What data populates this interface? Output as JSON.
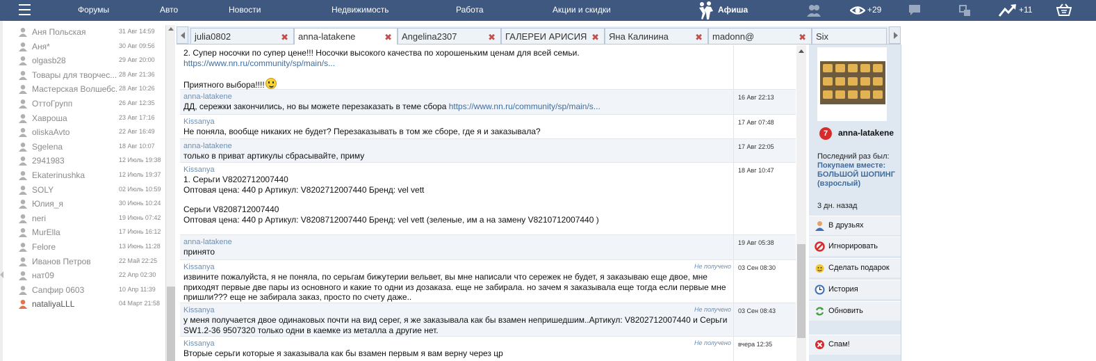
{
  "topbar": {
    "nav": [
      "Форумы",
      "Авто",
      "Новости",
      "Недвижимость",
      "Работа",
      "Акции и скидки"
    ],
    "afisha": "Афиша",
    "views_count": "+29",
    "notif_count": "+11",
    "bg_color": "#3e5880"
  },
  "contacts": [
    {
      "name": "Аня Польская",
      "date": "31 Авг 14:59"
    },
    {
      "name": "Аня*",
      "date": "30 Авг 09:56"
    },
    {
      "name": "olgasb28",
      "date": "29 Авг 20:00"
    },
    {
      "name": "Товары для творчес...",
      "date": "28 Авг 21:36"
    },
    {
      "name": "Мастерская Волшебс...",
      "date": "28 Авг 10:26"
    },
    {
      "name": "ОттоГрупп",
      "date": "26 Авг 12:35"
    },
    {
      "name": "Хаврошa",
      "date": "23 Авг 17:16"
    },
    {
      "name": "oliskaAvto",
      "date": "22 Авг 16:49"
    },
    {
      "name": "Sgelena",
      "date": "18 Авг 10:07"
    },
    {
      "name": "2941983",
      "date": "12 Июль 19:38"
    },
    {
      "name": "Ekaterinushka",
      "date": "12 Июль 19:37"
    },
    {
      "name": "SOLY",
      "date": "02 Июль 10:59"
    },
    {
      "name": "Юлия_я",
      "date": "30 Июнь 10:24"
    },
    {
      "name": "neri",
      "date": "19 Июнь 07:42"
    },
    {
      "name": "MurElla",
      "date": "17 Июнь 16:12"
    },
    {
      "name": "Felore",
      "date": "13 Июнь 11:28"
    },
    {
      "name": "Иванов Петров",
      "date": "22 Май 22:25"
    },
    {
      "name": "нат09",
      "date": "22 Апр 02:30"
    },
    {
      "name": "Сапфир 0603",
      "date": "10 Апр 11:39"
    },
    {
      "name": "nataliyaLLL",
      "date": "04 Март 21:58"
    }
  ],
  "tabs": [
    "julia0802",
    "anna-latakene",
    "Angelina2307",
    "ГАЛЕРЕИ АРИСИЯ",
    "Яна Калинина",
    "madonn@",
    "Six"
  ],
  "messages": [
    {
      "author": "",
      "time": "",
      "status": "",
      "lines": [
        "2. Супер носочки по супер цене!!! Носочки высокого качества по хорошеньким ценам для всей семьи."
      ],
      "link": "https://www.nn.ru/community/sp/main/s...",
      "extra": "Приятного выбора!!!!"
    },
    {
      "author": "anna-latakene",
      "time": "16 Авг 22:13",
      "status": "",
      "lines": [
        "ДД, сережки закончились, но вы можете перезаказать в теме сбора"
      ],
      "link": "https://www.nn.ru/community/sp/main/s..."
    },
    {
      "author": "Kissanya",
      "time": "17 Авг 07:48",
      "status": "",
      "lines": [
        "Не поняла, вообще никаких не будет? Перезаказывать в том же сборе, где я и заказывала?"
      ]
    },
    {
      "author": "anna-latakene",
      "time": "17 Авг 22:05",
      "status": "",
      "lines": [
        "только в приват артикулы сбрасывайте, приму"
      ]
    },
    {
      "author": "Kissanya",
      "time": "18 Авг 10:47",
      "status": "",
      "lines": [
        "1. Серьги V8202712007440",
        "Оптовая цена: 440 р Артикул: V8202712007440 Бренд: vel vett",
        "",
        "Серьги V8208712007440",
        "Оптовая цена: 440 р Артикул: V8208712007440 Бренд: vel vett (зеленые, им а на замену V8210712007440 )"
      ]
    },
    {
      "author": "anna-latakene",
      "time": "19 Авг 05:38",
      "status": "",
      "lines": [
        "принято"
      ]
    },
    {
      "author": "Kissanya",
      "time": "03 Сен 08:30",
      "status": "Не получено",
      "lines": [
        "извините пожалуйста, я не поняла, по серьгам бижутерии вельвет, вы мне написали что сережек не будет, я заказываю еще двое, мне",
        "приходят первые две пары из основного и какие то одни из дозаказа. еще не забирала. но зачем я заказывала еще тогда если первые мне",
        "пришли??? еще не забирала заказ, просто по счету даже.."
      ]
    },
    {
      "author": "Kissanya",
      "time": "03 Сен 08:43",
      "status": "Не получено",
      "lines": [
        "у меня получается двое одинаковых почти на вид серег, я же заказывала как бы взамен непришедшим..Артикул: V8202712007440 и Серьги",
        "SW1.2-36 9507320 только одни в каемке из металла а другие нет."
      ]
    },
    {
      "author": "Kissanya",
      "time": "вчера 12:35",
      "status": "Не получено",
      "lines": [
        "Вторые серьги которые я заказывала как бы взамен первым я вам верну через цр"
      ]
    }
  ],
  "profile": {
    "rating": "7",
    "name": "anna-latakene",
    "last_seen_label": "Последний раз был:",
    "last_place": "Покупаем вместе: БОЛЬШОЙ ШОПИНГ (взрослый)",
    "ago": "3 дн. назад"
  },
  "actions": [
    {
      "label": "В друзьях",
      "icon": "user-icon"
    },
    {
      "label": "Игнорировать",
      "icon": "block-icon"
    },
    {
      "label": "Сделать подарок",
      "icon": "gift-icon"
    },
    {
      "label": "История",
      "icon": "clock-icon"
    },
    {
      "label": "Обновить",
      "icon": "refresh-icon"
    },
    {
      "label": "Спам!",
      "icon": "spam-icon"
    }
  ]
}
